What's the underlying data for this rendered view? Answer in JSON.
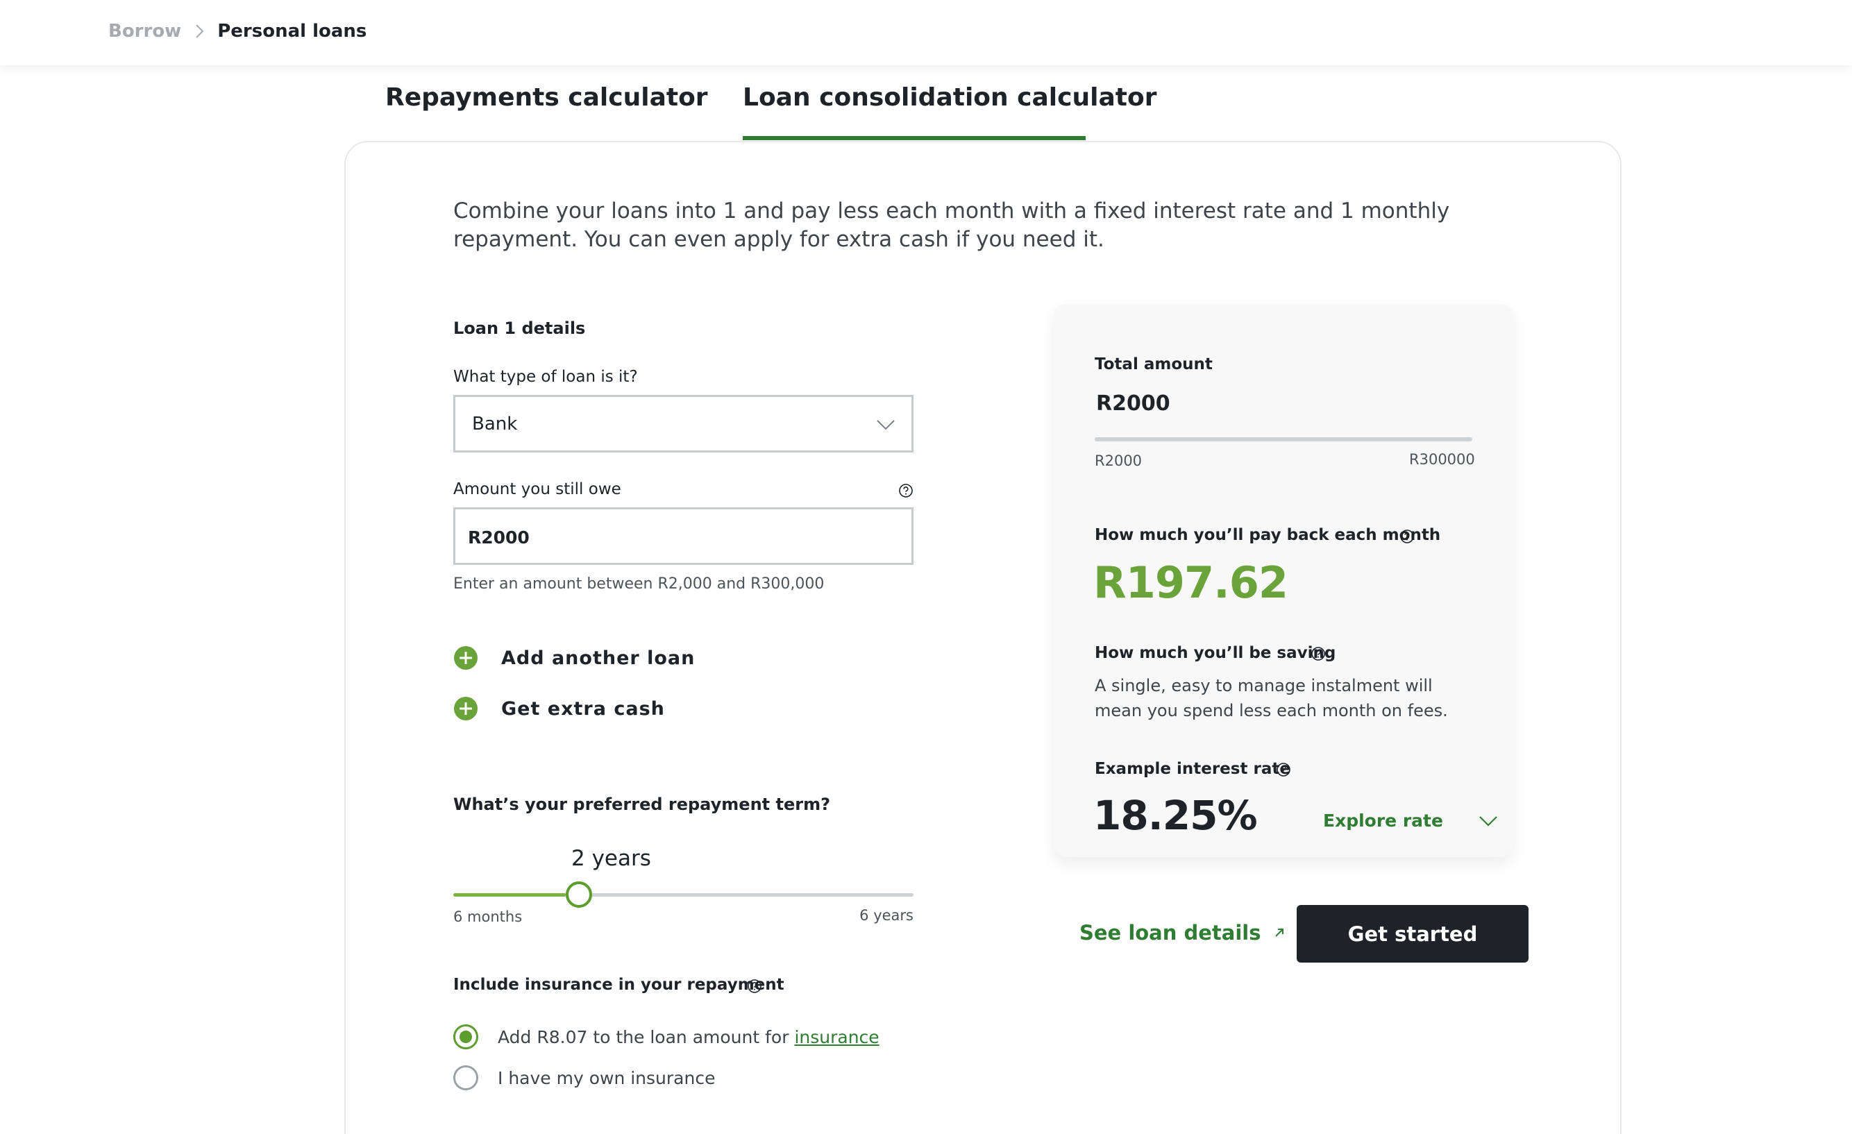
{
  "breadcrumb": {
    "parent": "Borrow",
    "current": "Personal loans"
  },
  "tabs": [
    {
      "label": "Repayments calculator",
      "active": false
    },
    {
      "label": "Loan consolidation calculator",
      "active": true
    }
  ],
  "intro": "Combine your loans into 1 and pay less each month with a fixed interest rate and 1 monthly repayment. You can even apply for extra cash if you need it.",
  "loan": {
    "title": "Loan 1 details",
    "type_label": "What type of loan is it?",
    "type_value": "Bank",
    "owe_label": "Amount you still owe",
    "owe_value": "R2000",
    "owe_hint": "Enter an amount between R2,000 and R300,000"
  },
  "actions": {
    "add_loan": "Add another loan",
    "extra_cash": "Get extra cash"
  },
  "term": {
    "title": "What’s your preferred repayment term?",
    "value": "2 years",
    "min_label": "6 months",
    "max_label": "6 years",
    "min_months": 6,
    "max_months": 72,
    "value_months": 24
  },
  "insurance": {
    "title": "Include insurance in your repayment",
    "option1_prefix": "Add R8.07 to the loan amount for ",
    "option1_link": "insurance",
    "option2": "I have my own insurance",
    "selected": 1
  },
  "summary": {
    "total_label": "Total amount",
    "total_value": "R2000",
    "total_min": "R2000",
    "total_max": "R300000",
    "monthly_label": "How much you’ll pay back each month",
    "monthly_value": "R197.62",
    "saving_label": "How much you’ll be saving",
    "saving_desc": "A single, easy to manage instalment will mean you spend less each month on fees.",
    "rate_label": "Example interest rate",
    "rate_value": "18.25%",
    "explore_label": "Explore rate"
  },
  "footer": {
    "details_link": "See loan details",
    "cta": "Get started"
  },
  "colors": {
    "brand_green": "#2f7d32",
    "accent_green": "#6aa33a",
    "dark": "#1d2329"
  }
}
